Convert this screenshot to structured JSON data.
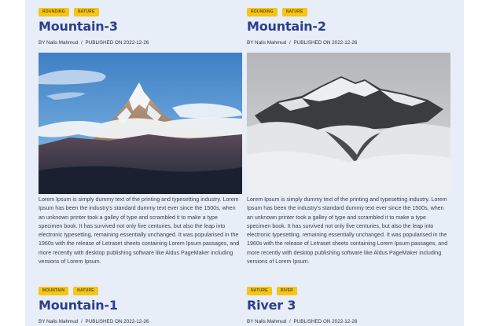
{
  "posts": [
    {
      "tags": [
        "ROUNDING",
        "NATURE"
      ],
      "title": "Mountain-3",
      "author_prefix": "BY",
      "author": "Nalis Mahmud",
      "published": "PUBLISHED ON 2022-12-26",
      "image": "mountain-sunny",
      "excerpt": "Lorem Ipsum is simply dummy text of the printing and typesetting industry. Lorem Ipsum has been the industry's standard dummy text ever since the 1500s, when an unknown printer took a galley of type and scrambled it to make a type specimen book. It has survived not only five centuries, but also the leap into electronic typesetting, remaining essentially unchanged. It was popularised in the 1960s with the release of Letraset sheets containing Lorem Ipsum passages, and more recently with desktop publishing software like Aldus PageMaker including versions of Lorem Ipsum."
    },
    {
      "tags": [
        "ROUNDING",
        "NATURE"
      ],
      "title": "Mountain-2",
      "author_prefix": "BY",
      "author": "Nalis Mahmud",
      "published": "PUBLISHED ON 2022-12-26",
      "image": "mountain-misty",
      "excerpt": "Lorem Ipsum is simply dummy text of the printing and typesetting industry. Lorem Ipsum has been the industry's standard dummy text ever since the 1500s, when an unknown printer took a galley of type and scrambled it to make a type specimen book. It has survived not only five centuries, but also the leap into electronic typesetting, remaining essentially unchanged. It was popularised in the 1960s with the release of Letraset sheets containing Lorem Ipsum passages, and more recently with desktop publishing software like Aldus PageMaker including versions of Lorem Ipsum."
    },
    {
      "tags": [
        "MOUNTAIN",
        "NATURE"
      ],
      "title": "Mountain-1",
      "author_prefix": "BY",
      "author": "Nalis Mahmud",
      "published": "PUBLISHED ON 2022-12-26"
    },
    {
      "tags": [
        "NATURE",
        "RIVER"
      ],
      "title": "River 3",
      "author_prefix": "BY",
      "author": "Nalis Mahmud",
      "published": "PUBLISHED ON 2022-12-26"
    }
  ]
}
